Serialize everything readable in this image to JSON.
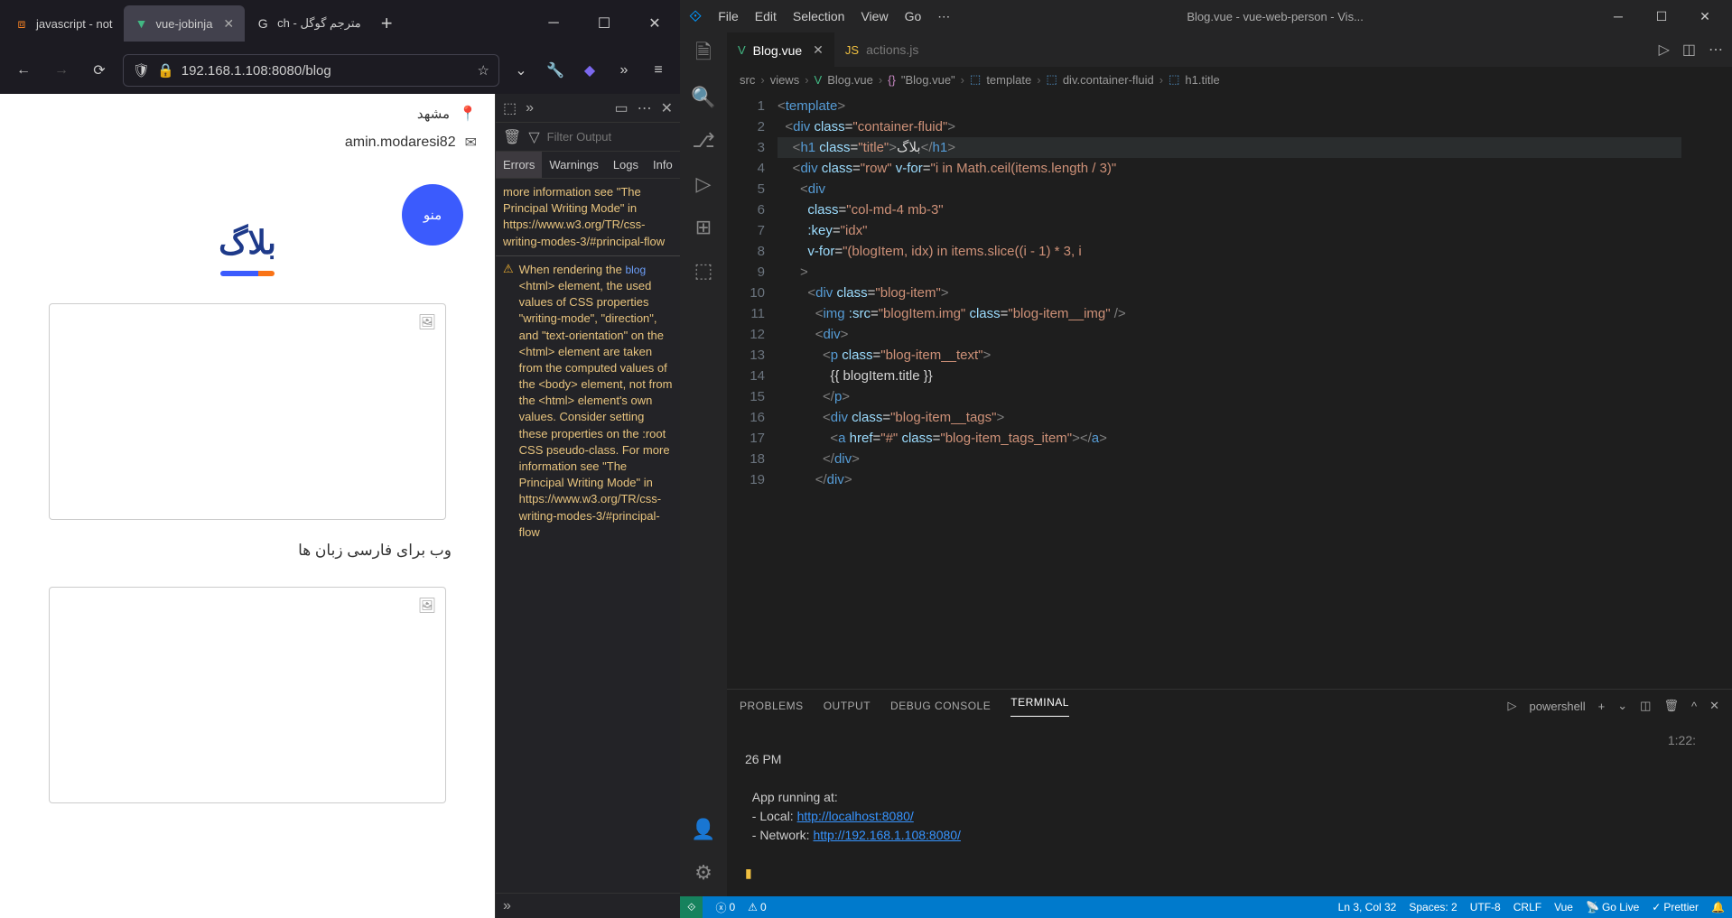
{
  "browser": {
    "tabs": [
      {
        "title": "javascript - not",
        "icon": "stackoverflow",
        "active": false
      },
      {
        "title": "vue-jobinja",
        "icon": "vue",
        "active": true
      },
      {
        "title": "ch - مترجم گوگل",
        "icon": "google",
        "active": false
      }
    ],
    "url": "192.168.1.108:8080/blog",
    "page": {
      "city": "مشهد",
      "menu_label": "منو",
      "user_email": "amin.modaresi82",
      "blog_title": "بلاگ",
      "card_caption": "وب برای فارسی زبان ها"
    },
    "devtools": {
      "filter_placeholder": "Filter Output",
      "tabs": [
        "Errors",
        "Warnings",
        "Logs",
        "Info"
      ],
      "msg1": "more information see \"The Principal Writing Mode\" in https://www.w3.org/TR/css-writing-modes-3/#principal-flow",
      "msg2_prefix": "When rendering the",
      "msg2_source": "blog",
      "msg2": "<html> element, the used values of CSS properties \"writing-mode\", \"direction\", and \"text-orientation\" on the <html> element are taken from the computed values of the <body> element, not from the <html> element's own values. Consider setting these properties on the :root CSS pseudo-class. For more information see \"The Principal Writing Mode\" in https://www.w3.org/TR/css-writing-modes-3/#principal-flow"
    }
  },
  "vscode": {
    "menu": [
      "File",
      "Edit",
      "Selection",
      "View",
      "Go"
    ],
    "title": "Blog.vue - vue-web-person - Vis...",
    "tabs": [
      {
        "name": "Blog.vue",
        "type": "vue",
        "active": true
      },
      {
        "name": "actions.js",
        "type": "js",
        "active": false
      }
    ],
    "breadcrumb": [
      "src",
      "views",
      "Blog.vue",
      "\"Blog.vue\"",
      "template",
      "div.container-fluid",
      "h1.title"
    ],
    "code_lines": [
      {
        "n": 1,
        "html": "<span class='tag-bracket'>&lt;</span><span class='tag-name'>template</span><span class='tag-bracket'>&gt;</span>"
      },
      {
        "n": 2,
        "html": "  <span class='tag-bracket'>&lt;</span><span class='tag-name'>div</span> <span class='attr-name'>class</span><span class='op'>=</span><span class='str'>\"container-fluid\"</span><span class='tag-bracket'>&gt;</span>"
      },
      {
        "n": 3,
        "html": "    <span class='tag-bracket'>&lt;</span><span class='tag-name'>h1</span> <span class='attr-name'>class</span><span class='op'>=</span><span class='str'>\"title\"</span><span class='tag-bracket'>&gt;</span><span class='txt'>بلاگ</span><span class='tag-bracket'>&lt;/</span><span class='tag-name'>h1</span><span class='tag-bracket'>&gt;</span>",
        "hl": true
      },
      {
        "n": 4,
        "html": "    <span class='tag-bracket'>&lt;</span><span class='tag-name'>div</span> <span class='attr-name'>class</span><span class='op'>=</span><span class='str'>\"row\"</span> <span class='attr-name'>v-for</span><span class='op'>=</span><span class='str'>\"i in Math.ceil(items.length / 3)\"</span>"
      },
      {
        "n": 5,
        "html": "      <span class='tag-bracket'>&lt;</span><span class='tag-name'>div</span>"
      },
      {
        "n": 6,
        "html": "        <span class='attr-name'>class</span><span class='op'>=</span><span class='str'>\"col-md-4 mb-3\"</span>"
      },
      {
        "n": 7,
        "html": "        <span class='attr-name'>:key</span><span class='op'>=</span><span class='str'>\"idx\"</span>"
      },
      {
        "n": 8,
        "html": "        <span class='attr-name'>v-for</span><span class='op'>=</span><span class='str'>\"(blogItem, idx) in items.slice((i - 1) * 3, i</span>"
      },
      {
        "n": 9,
        "html": "      <span class='tag-bracket'>&gt;</span>"
      },
      {
        "n": 10,
        "html": "        <span class='tag-bracket'>&lt;</span><span class='tag-name'>div</span> <span class='attr-name'>class</span><span class='op'>=</span><span class='str'>\"blog-item\"</span><span class='tag-bracket'>&gt;</span>"
      },
      {
        "n": 11,
        "html": "          <span class='tag-bracket'>&lt;</span><span class='tag-name'>img</span> <span class='attr-name'>:src</span><span class='op'>=</span><span class='str'>\"blogItem.img\"</span> <span class='attr-name'>class</span><span class='op'>=</span><span class='str'>\"blog-item__img\"</span> <span class='tag-bracket'>/&gt;</span>"
      },
      {
        "n": 12,
        "html": "          <span class='tag-bracket'>&lt;</span><span class='tag-name'>div</span><span class='tag-bracket'>&gt;</span>"
      },
      {
        "n": 13,
        "html": "            <span class='tag-bracket'>&lt;</span><span class='tag-name'>p</span> <span class='attr-name'>class</span><span class='op'>=</span><span class='str'>\"blog-item__text\"</span><span class='tag-bracket'>&gt;</span>"
      },
      {
        "n": 14,
        "html": "              <span class='txt'>{{ blogItem.title }}</span>"
      },
      {
        "n": 15,
        "html": "            <span class='tag-bracket'>&lt;/</span><span class='tag-name'>p</span><span class='tag-bracket'>&gt;</span>"
      },
      {
        "n": 16,
        "html": "            <span class='tag-bracket'>&lt;</span><span class='tag-name'>div</span> <span class='attr-name'>class</span><span class='op'>=</span><span class='str'>\"blog-item__tags\"</span><span class='tag-bracket'>&gt;</span>"
      },
      {
        "n": 17,
        "html": "              <span class='tag-bracket'>&lt;</span><span class='tag-name'>a</span> <span class='attr-name'>href</span><span class='op'>=</span><span class='str'>\"#\"</span> <span class='attr-name'>class</span><span class='op'>=</span><span class='str'>\"blog-item_tags_item\"</span><span class='tag-bracket'>&gt;&lt;/</span><span class='tag-name'>a</span><span class='tag-bracket'>&gt;</span>"
      },
      {
        "n": 18,
        "html": "            <span class='tag-bracket'>&lt;/</span><span class='tag-name'>div</span><span class='tag-bracket'>&gt;</span>"
      },
      {
        "n": 19,
        "html": "          <span class='tag-bracket'>&lt;/</span><span class='tag-name'>div</span><span class='tag-bracket'>&gt;</span>"
      }
    ],
    "panel": {
      "tabs": [
        "PROBLEMS",
        "OUTPUT",
        "DEBUG CONSOLE",
        "TERMINAL"
      ],
      "shell": "powershell",
      "time": "1:22:",
      "term_line0": "26 PM",
      "term_line1": "App running at:",
      "term_line2": "- Local:   ",
      "term_link2": "http://localhost:8080/",
      "term_line3": "- Network: ",
      "term_link3": "http://192.168.1.108:8080/"
    },
    "status": {
      "cursor": "Ln 3, Col 32",
      "spaces": "Spaces: 2",
      "encoding": "UTF-8",
      "eol": "CRLF",
      "lang": "Vue",
      "golive": "Go Live",
      "prettier": "Prettier",
      "errors": "0",
      "warnings": "0"
    }
  }
}
